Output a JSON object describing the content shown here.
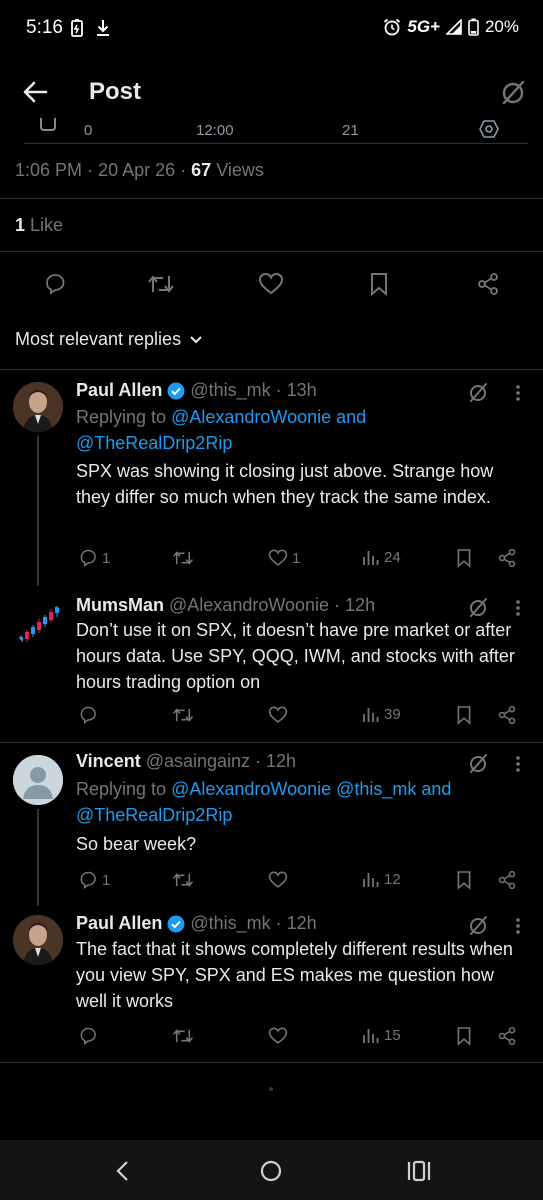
{
  "status_bar": {
    "time": "5:16",
    "network": "5G+",
    "battery": "20%"
  },
  "header": {
    "title": "Post"
  },
  "chart_strip": {
    "left_label": "0",
    "mid_label": "12:00",
    "right_label": "21"
  },
  "post_meta": {
    "time": "1:06 PM",
    "date": "20 Apr 26",
    "views_count": "67",
    "views_label": "Views",
    "sep": "·"
  },
  "likes": {
    "count": "1",
    "label": "Like"
  },
  "sort": {
    "label": "Most relevant replies"
  },
  "replies": [
    {
      "name": "Paul Allen",
      "handle": "@this_mk",
      "time": "13h",
      "replying_prefix": "Replying to",
      "replying_to_1": "@AlexandroWoonie and",
      "replying_to_2": "@TheRealDrip2Rip",
      "text": "SPX was showing it closing just above. Strange how they differ so much when they track the same index.",
      "replies_count": "1",
      "likes_count": "1",
      "views_count": "24"
    },
    {
      "name": "MumsMan",
      "handle": "@AlexandroWoonie",
      "time": "12h",
      "text": "Don’t use it on SPX, it doesn’t have pre market or after hours data. Use SPY, QQQ, IWM, and stocks with after hours trading option on",
      "views_count": "39"
    },
    {
      "name": "Vincent",
      "handle": "@asaingainz",
      "time": "12h",
      "replying_prefix": "Replying to",
      "replying_to_1": "@AlexandroWoonie @this_mk and",
      "replying_to_2": "@TheRealDrip2Rip",
      "text": "So bear week?",
      "replies_count": "1",
      "views_count": "12"
    },
    {
      "name": "Paul Allen",
      "handle": "@this_mk",
      "time": "12h",
      "text": "The fact that it shows completely different results when you view SPY, SPX and ES makes me question how well it works",
      "views_count": "15"
    }
  ],
  "colors": {
    "accent": "#1d9bf0",
    "text_primary": "#e7e9ea",
    "text_secondary": "#71767b",
    "divider": "#2f3336",
    "background": "#000000"
  },
  "icons": [
    "back-arrow-icon",
    "grok-icon",
    "reply-icon",
    "repost-icon",
    "like-icon",
    "bookmark-icon",
    "share-icon",
    "views-icon",
    "more-icon",
    "verified-icon"
  ]
}
